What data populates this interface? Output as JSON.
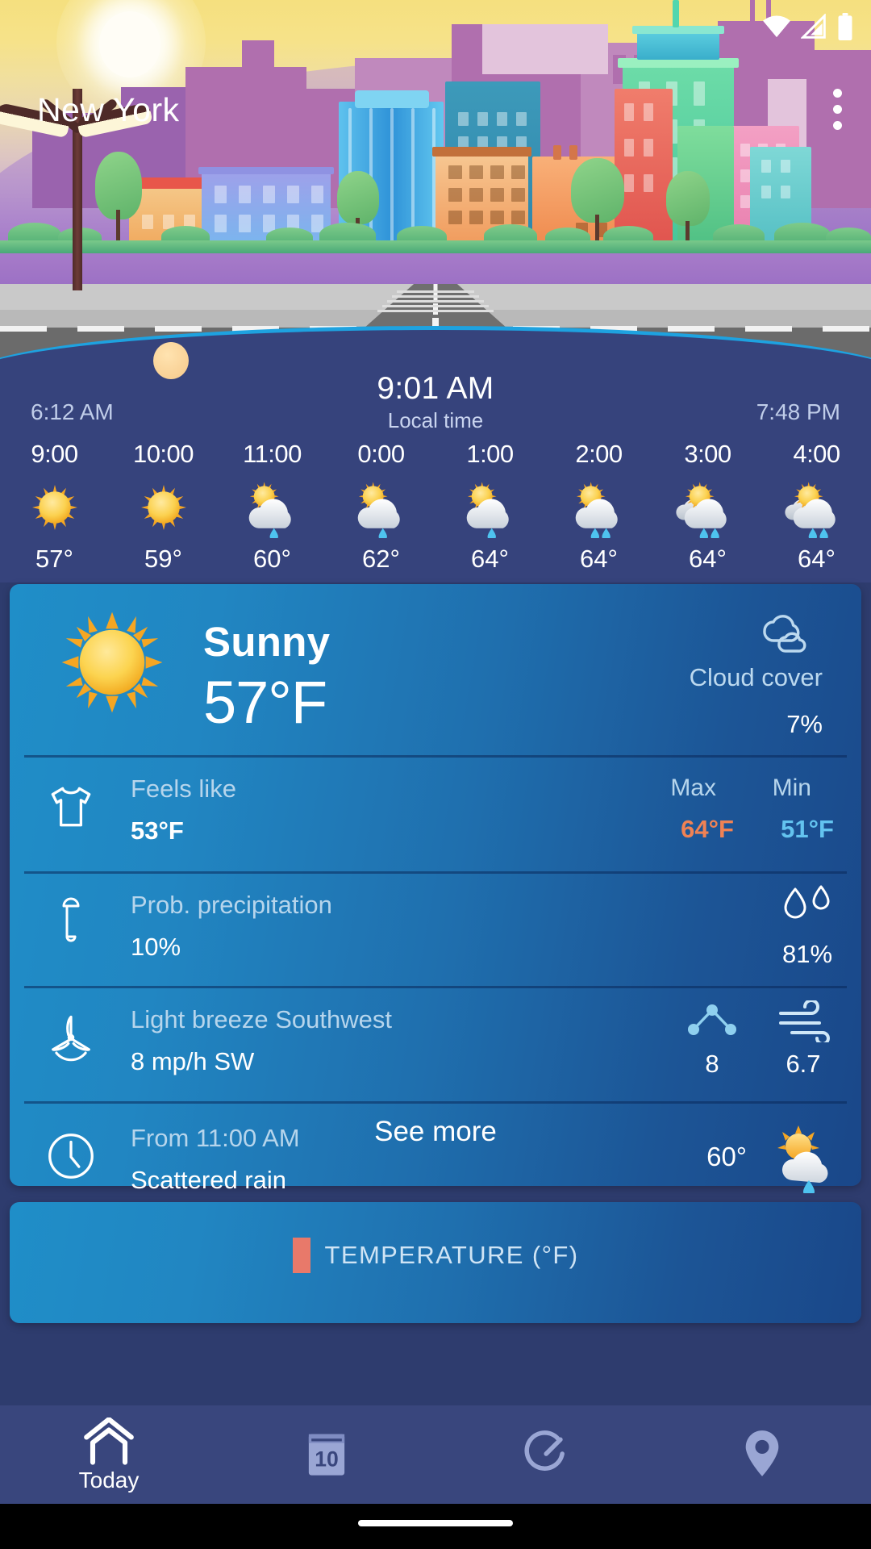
{
  "status_bar": {
    "wifi_icon": "wifi-icon",
    "signal_icon": "cellular-signal-icon",
    "battery_icon": "battery-icon"
  },
  "header": {
    "city": "New York",
    "overflow_menu": "overflow-menu-icon",
    "scene": "city-skyline-illustration"
  },
  "sun_panel": {
    "sunrise": "6:12 AM",
    "sunset": "7:48 PM",
    "current_time": "9:01 AM",
    "time_label": "Local time"
  },
  "hourly": [
    {
      "time": "9:00",
      "icon": "sunny",
      "temp": "57°"
    },
    {
      "time": "10:00",
      "icon": "sunny",
      "temp": "59°"
    },
    {
      "time": "11:00",
      "icon": "sun-rain-1",
      "temp": "60°"
    },
    {
      "time": "0:00",
      "icon": "sun-rain-1",
      "temp": "62°"
    },
    {
      "time": "1:00",
      "icon": "sun-rain-1",
      "temp": "64°"
    },
    {
      "time": "2:00",
      "icon": "sun-rain-2",
      "temp": "64°"
    },
    {
      "time": "3:00",
      "icon": "clouds-rain-2",
      "temp": "64°"
    },
    {
      "time": "4:00",
      "icon": "clouds-rain-2",
      "temp": "64°"
    }
  ],
  "current": {
    "icon": "sunny",
    "condition": "Sunny",
    "temperature": "57°F",
    "cloud_cover_icon": "cloud-outline-icon",
    "cloud_cover_label": "Cloud cover",
    "cloud_cover_value": "7%"
  },
  "details": {
    "feels_like": {
      "icon": "tshirt-icon",
      "label": "Feels like",
      "value": "53°F",
      "max_label": "Max",
      "max_value": "64°F",
      "min_label": "Min",
      "min_value": "51°F"
    },
    "precipitation": {
      "icon": "umbrella-icon",
      "label": "Prob. precipitation",
      "value": "10%",
      "humidity_icon": "water-drops-icon",
      "humidity_value": "81%"
    },
    "wind": {
      "icon": "wind-turbine-icon",
      "label": "Light breeze Southwest",
      "value": "8 mp/h SW",
      "aqi_icon": "air-quality-icon",
      "aqi_value": "8",
      "gust_icon": "wind-lines-icon",
      "gust_value": "6.7"
    },
    "forecast_change": {
      "icon": "clock-icon",
      "label": "From 11:00 AM",
      "value": "Scattered rain",
      "temp": "60°",
      "weather_icon": "sun-rain-1"
    }
  },
  "see_more": {
    "label": "See more"
  },
  "chart_card": {
    "legend_color": "#e8796a",
    "title": "TEMPERATURE (°F)"
  },
  "nav": [
    {
      "id": "today",
      "icon": "home-icon",
      "label": "Today",
      "active": true
    },
    {
      "id": "forecast",
      "icon": "calendar-10-icon",
      "label": "",
      "active": false
    },
    {
      "id": "radar",
      "icon": "radar-icon",
      "label": "",
      "active": false
    },
    {
      "id": "places",
      "icon": "location-pin-icon",
      "label": "",
      "active": false
    }
  ],
  "colors": {
    "background": "#2e3c6e",
    "panel": "#36437c",
    "card_light": "#1f8ec8",
    "card_dark": "#1a4789",
    "accent_arc": "#1ea2e0",
    "max_temp": "#f08254",
    "min_temp": "#63c3ef",
    "nav_bar": "#39467d"
  }
}
